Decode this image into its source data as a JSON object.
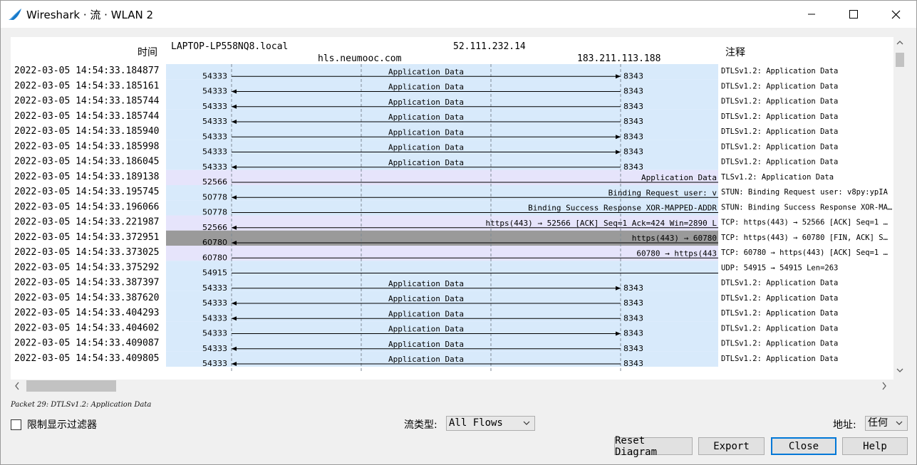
{
  "window": {
    "title": "Wireshark · 流 · WLAN 2"
  },
  "diagram": {
    "time_header": "时间",
    "comment_header": "注释",
    "hosts": [
      "LAPTOP-LP558NQ8.local",
      "hls.neumooc.com",
      "52.111.232.14",
      "183.211.113.188"
    ],
    "rows": [
      {
        "time": "2022-03-05 14:54:33.184877",
        "src_port": "54333",
        "dst_port": "8343",
        "label": "Application Data",
        "comment": "DTLSv1.2: Application Data",
        "dir": "right",
        "from": 0,
        "to": 3,
        "bg": "#d8eafb"
      },
      {
        "time": "2022-03-05 14:54:33.185161",
        "src_port": "54333",
        "dst_port": "8343",
        "label": "Application Data",
        "comment": "DTLSv1.2: Application Data",
        "dir": "left",
        "from": 0,
        "to": 3,
        "bg": "#d8eafb"
      },
      {
        "time": "2022-03-05 14:54:33.185744",
        "src_port": "54333",
        "dst_port": "8343",
        "label": "Application Data",
        "comment": "DTLSv1.2: Application Data",
        "dir": "left",
        "from": 0,
        "to": 3,
        "bg": "#d8eafb"
      },
      {
        "time": "2022-03-05 14:54:33.185744",
        "src_port": "54333",
        "dst_port": "8343",
        "label": "Application Data",
        "comment": "DTLSv1.2: Application Data",
        "dir": "left",
        "from": 0,
        "to": 3,
        "bg": "#d8eafb"
      },
      {
        "time": "2022-03-05 14:54:33.185940",
        "src_port": "54333",
        "dst_port": "8343",
        "label": "Application Data",
        "comment": "DTLSv1.2: Application Data",
        "dir": "right",
        "from": 0,
        "to": 3,
        "bg": "#d8eafb"
      },
      {
        "time": "2022-03-05 14:54:33.185998",
        "src_port": "54333",
        "dst_port": "8343",
        "label": "Application Data",
        "comment": "DTLSv1.2: Application Data",
        "dir": "right",
        "from": 0,
        "to": 3,
        "bg": "#d8eafb"
      },
      {
        "time": "2022-03-05 14:54:33.186045",
        "src_port": "54333",
        "dst_port": "8343",
        "label": "Application Data",
        "comment": "DTLSv1.2: Application Data",
        "dir": "left",
        "from": 0,
        "to": 3,
        "bg": "#d8eafb"
      },
      {
        "time": "2022-03-05 14:54:33.189138",
        "src_port": "52566",
        "dst_port": "",
        "label": "Application Data",
        "comment": "TLSv1.2: Application Data",
        "dir": "right",
        "from": 0,
        "to": 4,
        "bg": "#e6e4fb"
      },
      {
        "time": "2022-03-05 14:54:33.195745",
        "src_port": "50778",
        "dst_port": "",
        "label": "Binding Request user: v",
        "comment": "STUN: Binding Request user: v8py:ypIA",
        "dir": "left",
        "from": 0,
        "to": 4,
        "bg": "#d8eafb"
      },
      {
        "time": "2022-03-05 14:54:33.196066",
        "src_port": "50778",
        "dst_port": "",
        "label": "Binding Success Response XOR-MAPPED-ADDR",
        "comment": "STUN: Binding Success Response XOR-MA…",
        "dir": "right",
        "from": 0,
        "to": 4,
        "bg": "#d8eafb"
      },
      {
        "time": "2022-03-05 14:54:33.221987",
        "src_port": "52566",
        "dst_port": "",
        "label": "https(443) → 52566 [ACK] Seq=1 Ack=424 Win=2890 L",
        "comment": "TCP: https(443) → 52566 [ACK] Seq=1 …",
        "dir": "left",
        "from": 0,
        "to": 4,
        "bg": "#e6e4fb"
      },
      {
        "time": "2022-03-05 14:54:33.372951",
        "src_port": "60780",
        "dst_port": "",
        "label": "https(443) → 60780",
        "comment": "TCP: https(443) → 60780 [FIN, ACK] S…",
        "dir": "left",
        "from": 0,
        "to": 4,
        "bg": "#9a9a9a"
      },
      {
        "time": "2022-03-05 14:54:33.373025",
        "src_port": "60780",
        "dst_port": "",
        "label": "60780 → https(443",
        "comment": "TCP: 60780 → https(443) [ACK] Seq=1 …",
        "dir": "right",
        "from": 0,
        "to": 4,
        "bg": "#e6e4fb"
      },
      {
        "time": "2022-03-05 14:54:33.375292",
        "src_port": "54915",
        "dst_port": "",
        "label": "",
        "comment": "UDP: 54915 → 54915 Len=263",
        "dir": "right",
        "from": 0,
        "to": 4,
        "bg": "#d8eafb"
      },
      {
        "time": "2022-03-05 14:54:33.387397",
        "src_port": "54333",
        "dst_port": "8343",
        "label": "Application Data",
        "comment": "DTLSv1.2: Application Data",
        "dir": "right",
        "from": 0,
        "to": 3,
        "bg": "#d8eafb"
      },
      {
        "time": "2022-03-05 14:54:33.387620",
        "src_port": "54333",
        "dst_port": "8343",
        "label": "Application Data",
        "comment": "DTLSv1.2: Application Data",
        "dir": "left",
        "from": 0,
        "to": 3,
        "bg": "#d8eafb"
      },
      {
        "time": "2022-03-05 14:54:33.404293",
        "src_port": "54333",
        "dst_port": "8343",
        "label": "Application Data",
        "comment": "DTLSv1.2: Application Data",
        "dir": "left",
        "from": 0,
        "to": 3,
        "bg": "#d8eafb"
      },
      {
        "time": "2022-03-05 14:54:33.404602",
        "src_port": "54333",
        "dst_port": "8343",
        "label": "Application Data",
        "comment": "DTLSv1.2: Application Data",
        "dir": "right",
        "from": 0,
        "to": 3,
        "bg": "#d8eafb"
      },
      {
        "time": "2022-03-05 14:54:33.409087",
        "src_port": "54333",
        "dst_port": "8343",
        "label": "Application Data",
        "comment": "DTLSv1.2: Application Data",
        "dir": "left",
        "from": 0,
        "to": 3,
        "bg": "#d8eafb"
      },
      {
        "time": "2022-03-05 14:54:33.409805",
        "src_port": "54333",
        "dst_port": "8343",
        "label": "Application Data",
        "comment": "DTLSv1.2: Application Data",
        "dir": "left",
        "from": 0,
        "to": 3,
        "bg": "#d8eafb"
      }
    ]
  },
  "status_text": "Packet 29: DTLSv1.2: Application Data",
  "controls": {
    "limit_filter_label": "限制显示过滤器",
    "flow_type_label": "流类型:",
    "flow_type_value": "All Flows",
    "address_label": "地址:",
    "address_value": "任何",
    "reset_label": "Reset Diagram",
    "export_label": "Export",
    "close_label": "Close",
    "help_label": "Help"
  }
}
